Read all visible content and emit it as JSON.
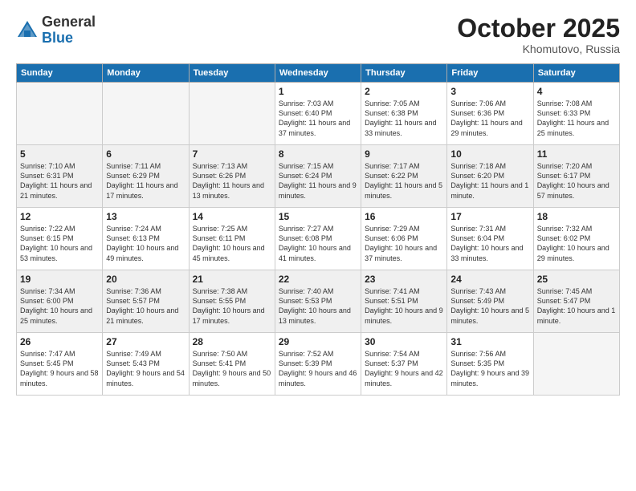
{
  "header": {
    "logo_general": "General",
    "logo_blue": "Blue",
    "month": "October 2025",
    "location": "Khomutovo, Russia"
  },
  "weekdays": [
    "Sunday",
    "Monday",
    "Tuesday",
    "Wednesday",
    "Thursday",
    "Friday",
    "Saturday"
  ],
  "weeks": [
    [
      {
        "day": "",
        "content": ""
      },
      {
        "day": "",
        "content": ""
      },
      {
        "day": "",
        "content": ""
      },
      {
        "day": "1",
        "content": "Sunrise: 7:03 AM\nSunset: 6:40 PM\nDaylight: 11 hours\nand 37 minutes."
      },
      {
        "day": "2",
        "content": "Sunrise: 7:05 AM\nSunset: 6:38 PM\nDaylight: 11 hours\nand 33 minutes."
      },
      {
        "day": "3",
        "content": "Sunrise: 7:06 AM\nSunset: 6:36 PM\nDaylight: 11 hours\nand 29 minutes."
      },
      {
        "day": "4",
        "content": "Sunrise: 7:08 AM\nSunset: 6:33 PM\nDaylight: 11 hours\nand 25 minutes."
      }
    ],
    [
      {
        "day": "5",
        "content": "Sunrise: 7:10 AM\nSunset: 6:31 PM\nDaylight: 11 hours\nand 21 minutes."
      },
      {
        "day": "6",
        "content": "Sunrise: 7:11 AM\nSunset: 6:29 PM\nDaylight: 11 hours\nand 17 minutes."
      },
      {
        "day": "7",
        "content": "Sunrise: 7:13 AM\nSunset: 6:26 PM\nDaylight: 11 hours\nand 13 minutes."
      },
      {
        "day": "8",
        "content": "Sunrise: 7:15 AM\nSunset: 6:24 PM\nDaylight: 11 hours\nand 9 minutes."
      },
      {
        "day": "9",
        "content": "Sunrise: 7:17 AM\nSunset: 6:22 PM\nDaylight: 11 hours\nand 5 minutes."
      },
      {
        "day": "10",
        "content": "Sunrise: 7:18 AM\nSunset: 6:20 PM\nDaylight: 11 hours\nand 1 minute."
      },
      {
        "day": "11",
        "content": "Sunrise: 7:20 AM\nSunset: 6:17 PM\nDaylight: 10 hours\nand 57 minutes."
      }
    ],
    [
      {
        "day": "12",
        "content": "Sunrise: 7:22 AM\nSunset: 6:15 PM\nDaylight: 10 hours\nand 53 minutes."
      },
      {
        "day": "13",
        "content": "Sunrise: 7:24 AM\nSunset: 6:13 PM\nDaylight: 10 hours\nand 49 minutes."
      },
      {
        "day": "14",
        "content": "Sunrise: 7:25 AM\nSunset: 6:11 PM\nDaylight: 10 hours\nand 45 minutes."
      },
      {
        "day": "15",
        "content": "Sunrise: 7:27 AM\nSunset: 6:08 PM\nDaylight: 10 hours\nand 41 minutes."
      },
      {
        "day": "16",
        "content": "Sunrise: 7:29 AM\nSunset: 6:06 PM\nDaylight: 10 hours\nand 37 minutes."
      },
      {
        "day": "17",
        "content": "Sunrise: 7:31 AM\nSunset: 6:04 PM\nDaylight: 10 hours\nand 33 minutes."
      },
      {
        "day": "18",
        "content": "Sunrise: 7:32 AM\nSunset: 6:02 PM\nDaylight: 10 hours\nand 29 minutes."
      }
    ],
    [
      {
        "day": "19",
        "content": "Sunrise: 7:34 AM\nSunset: 6:00 PM\nDaylight: 10 hours\nand 25 minutes."
      },
      {
        "day": "20",
        "content": "Sunrise: 7:36 AM\nSunset: 5:57 PM\nDaylight: 10 hours\nand 21 minutes."
      },
      {
        "day": "21",
        "content": "Sunrise: 7:38 AM\nSunset: 5:55 PM\nDaylight: 10 hours\nand 17 minutes."
      },
      {
        "day": "22",
        "content": "Sunrise: 7:40 AM\nSunset: 5:53 PM\nDaylight: 10 hours\nand 13 minutes."
      },
      {
        "day": "23",
        "content": "Sunrise: 7:41 AM\nSunset: 5:51 PM\nDaylight: 10 hours\nand 9 minutes."
      },
      {
        "day": "24",
        "content": "Sunrise: 7:43 AM\nSunset: 5:49 PM\nDaylight: 10 hours\nand 5 minutes."
      },
      {
        "day": "25",
        "content": "Sunrise: 7:45 AM\nSunset: 5:47 PM\nDaylight: 10 hours\nand 1 minute."
      }
    ],
    [
      {
        "day": "26",
        "content": "Sunrise: 7:47 AM\nSunset: 5:45 PM\nDaylight: 9 hours\nand 58 minutes."
      },
      {
        "day": "27",
        "content": "Sunrise: 7:49 AM\nSunset: 5:43 PM\nDaylight: 9 hours\nand 54 minutes."
      },
      {
        "day": "28",
        "content": "Sunrise: 7:50 AM\nSunset: 5:41 PM\nDaylight: 9 hours\nand 50 minutes."
      },
      {
        "day": "29",
        "content": "Sunrise: 7:52 AM\nSunset: 5:39 PM\nDaylight: 9 hours\nand 46 minutes."
      },
      {
        "day": "30",
        "content": "Sunrise: 7:54 AM\nSunset: 5:37 PM\nDaylight: 9 hours\nand 42 minutes."
      },
      {
        "day": "31",
        "content": "Sunrise: 7:56 AM\nSunset: 5:35 PM\nDaylight: 9 hours\nand 39 minutes."
      },
      {
        "day": "",
        "content": ""
      }
    ]
  ]
}
